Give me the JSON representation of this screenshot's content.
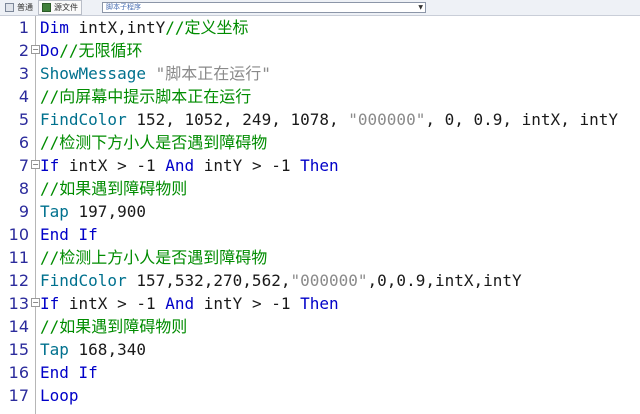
{
  "toolbar": {
    "tab_normal": "普通",
    "tab_source": "源文件",
    "select_value": "脚本子程序"
  },
  "lines": [
    {
      "n": "1",
      "segs": [
        {
          "k": "kw",
          "t": "Dim"
        },
        {
          "k": "tx",
          "t": " intX,intY"
        },
        {
          "k": "cm",
          "t": "//定义坐标"
        }
      ]
    },
    {
      "n": "2",
      "fold": "−",
      "segs": [
        {
          "k": "kw",
          "t": "Do"
        },
        {
          "k": "cm",
          "t": "//无限循环"
        }
      ]
    },
    {
      "n": "3",
      "segs": [
        {
          "k": "fn",
          "t": "ShowMessage"
        },
        {
          "k": "tx",
          "t": " "
        },
        {
          "k": "st",
          "t": "\"脚本正在运行\""
        }
      ]
    },
    {
      "n": "4",
      "segs": [
        {
          "k": "cm",
          "t": "//向屏幕中提示脚本正在运行"
        }
      ]
    },
    {
      "n": "5",
      "segs": [
        {
          "k": "fn",
          "t": "FindColor"
        },
        {
          "k": "tx",
          "t": " 152, 1052, 249, 1078, "
        },
        {
          "k": "st",
          "t": "\"000000\""
        },
        {
          "k": "tx",
          "t": ", 0, 0.9, intX, intY"
        }
      ]
    },
    {
      "n": "6",
      "segs": [
        {
          "k": "cm",
          "t": "//检测下方小人是否遇到障碍物"
        }
      ]
    },
    {
      "n": "7",
      "fold": "−",
      "segs": [
        {
          "k": "kw",
          "t": "If"
        },
        {
          "k": "tx",
          "t": " intX > -1 "
        },
        {
          "k": "kw",
          "t": "And"
        },
        {
          "k": "tx",
          "t": " intY > -1 "
        },
        {
          "k": "kw",
          "t": "Then"
        }
      ]
    },
    {
      "n": "8",
      "segs": [
        {
          "k": "cm",
          "t": "//如果遇到障碍物则"
        }
      ]
    },
    {
      "n": "9",
      "segs": [
        {
          "k": "fn",
          "t": "Tap"
        },
        {
          "k": "tx",
          "t": " 197,900"
        }
      ]
    },
    {
      "n": "10",
      "segs": [
        {
          "k": "kw",
          "t": "End If"
        }
      ]
    },
    {
      "n": "11",
      "segs": [
        {
          "k": "cm",
          "t": "//检测上方小人是否遇到障碍物"
        }
      ]
    },
    {
      "n": "12",
      "segs": [
        {
          "k": "fn",
          "t": "FindColor"
        },
        {
          "k": "tx",
          "t": " 157,532,270,562,"
        },
        {
          "k": "st",
          "t": "\"000000\""
        },
        {
          "k": "tx",
          "t": ",0,0.9,intX,intY"
        }
      ]
    },
    {
      "n": "13",
      "fold": "−",
      "segs": [
        {
          "k": "kw",
          "t": "If"
        },
        {
          "k": "tx",
          "t": " intX > -1 "
        },
        {
          "k": "kw",
          "t": "And"
        },
        {
          "k": "tx",
          "t": " intY > -1 "
        },
        {
          "k": "kw",
          "t": "Then"
        }
      ]
    },
    {
      "n": "14",
      "segs": [
        {
          "k": "cm",
          "t": "//如果遇到障碍物则"
        }
      ]
    },
    {
      "n": "15",
      "segs": [
        {
          "k": "fn",
          "t": "Tap"
        },
        {
          "k": "tx",
          "t": " 168,340"
        }
      ]
    },
    {
      "n": "16",
      "segs": [
        {
          "k": "kw",
          "t": "End If"
        }
      ]
    },
    {
      "n": "17",
      "segs": [
        {
          "k": "kw",
          "t": "Loop"
        }
      ]
    }
  ]
}
